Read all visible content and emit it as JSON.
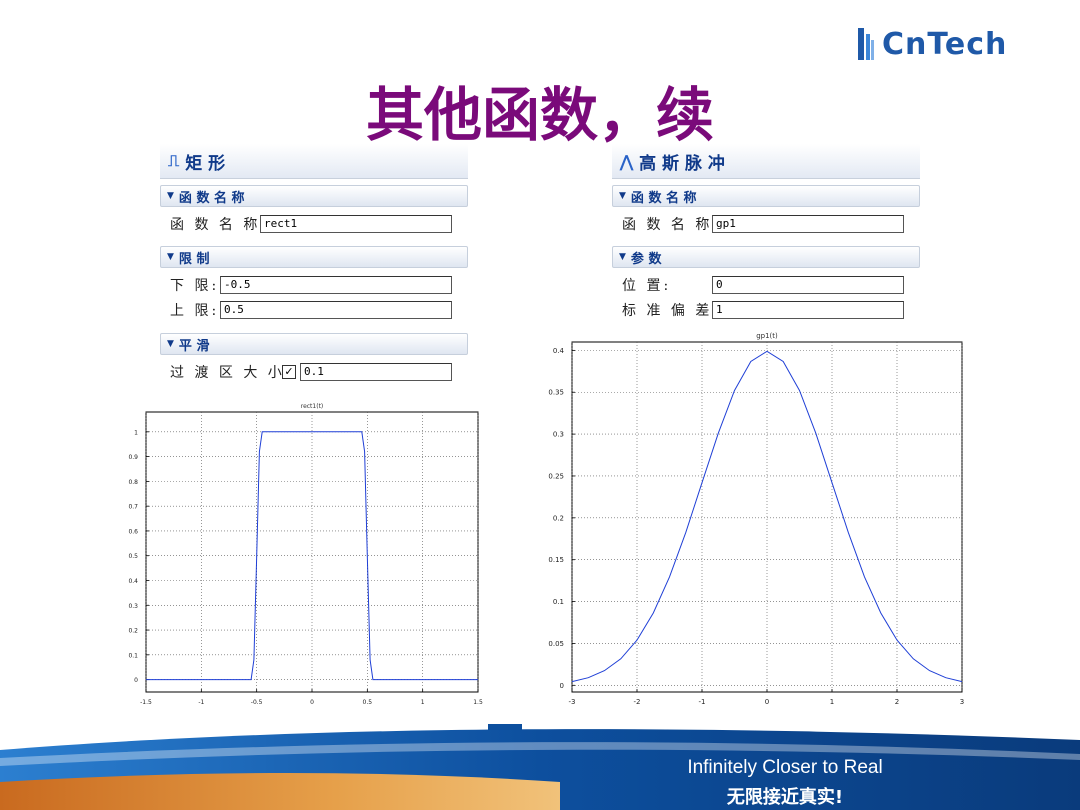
{
  "logo": {
    "text": "CnTech",
    "mark": "cntech-logo-mark",
    "color": "#1f59a8"
  },
  "title": "其他函数，续",
  "left_panel": {
    "icon": "rect-pulse-icon",
    "icon_glyph": "⎍",
    "header": "矩 形",
    "sections": {
      "func_name": {
        "label": "函 数 名 称",
        "field_label": "函 数 名 称:",
        "value": "rect1"
      },
      "limits": {
        "label": "限 制",
        "lower_label": "下 限:",
        "lower_value": "-0.5",
        "upper_label": "上 限:",
        "upper_value": "0.5"
      },
      "smooth": {
        "label": "平 滑",
        "transition_label": "过 渡 区 大 小:",
        "checkbox_mark": "✓",
        "transition_value": "0.1"
      }
    }
  },
  "right_panel": {
    "icon": "gaussian-pulse-icon",
    "icon_glyph": "⋀",
    "header": "高 斯 脉 冲",
    "sections": {
      "func_name": {
        "label": "函 数 名 称",
        "field_label": "函 数 名 称:",
        "value": "gp1"
      },
      "params": {
        "label": "参 数",
        "position_label": "位 置:",
        "position_value": "0",
        "std_label": "标 准 偏 差:",
        "std_value": "1"
      }
    }
  },
  "chart_data": [
    {
      "type": "line",
      "title": "rect1(t)",
      "xlim": [
        -1.5,
        1.5
      ],
      "ylim": [
        -0.05,
        1.08
      ],
      "xticks": [
        "-1.5",
        "-1",
        "-0.5",
        "0",
        "0.5",
        "1",
        "1.5"
      ],
      "yticks": [
        "0",
        "0.1",
        "0.2",
        "0.3",
        "0.4",
        "0.5",
        "0.6",
        "0.7",
        "0.8",
        "0.9",
        "1"
      ],
      "grid": true,
      "series": [
        {
          "color": "#1f3fd6",
          "x": [
            -1.5,
            -0.55,
            -0.525,
            -0.5,
            -0.475,
            -0.45,
            0.45,
            0.475,
            0.5,
            0.525,
            0.55,
            1.5
          ],
          "y": [
            0,
            0,
            0.08,
            0.5,
            0.92,
            1,
            1,
            0.92,
            0.5,
            0.08,
            0,
            0
          ]
        }
      ]
    },
    {
      "type": "line",
      "title": "gp1(t)",
      "xlim": [
        -3,
        3
      ],
      "ylim": [
        -0.008,
        0.41
      ],
      "xticks": [
        "-3",
        "-2",
        "-1",
        "0",
        "1",
        "2",
        "3"
      ],
      "yticks": [
        "0",
        "0.05",
        "0.1",
        "0.15",
        "0.2",
        "0.25",
        "0.3",
        "0.35",
        "0.4"
      ],
      "grid": true,
      "series": [
        {
          "color": "#1f3fd6",
          "x": [
            -3,
            -2.75,
            -2.5,
            -2.25,
            -2,
            -1.75,
            -1.5,
            -1.25,
            -1,
            -0.75,
            -0.5,
            -0.25,
            0,
            0.25,
            0.5,
            0.75,
            1,
            1.25,
            1.5,
            1.75,
            2,
            2.25,
            2.5,
            2.75,
            3
          ],
          "y": [
            0.0044,
            0.0091,
            0.0175,
            0.0317,
            0.054,
            0.0863,
            0.1295,
            0.1826,
            0.242,
            0.3011,
            0.3521,
            0.3867,
            0.3989,
            0.3867,
            0.3521,
            0.3011,
            0.242,
            0.1826,
            0.1295,
            0.0863,
            0.054,
            0.0317,
            0.0175,
            0.0091,
            0.0044
          ]
        }
      ]
    }
  ],
  "footer": {
    "tagline_en": "Infinitely Closer to Real",
    "tagline_zh": "无限接近真实!",
    "colors": {
      "blue_dark": "#0a3f86",
      "blue_light": "#1e6fc0",
      "orange": "#d9822b"
    }
  }
}
